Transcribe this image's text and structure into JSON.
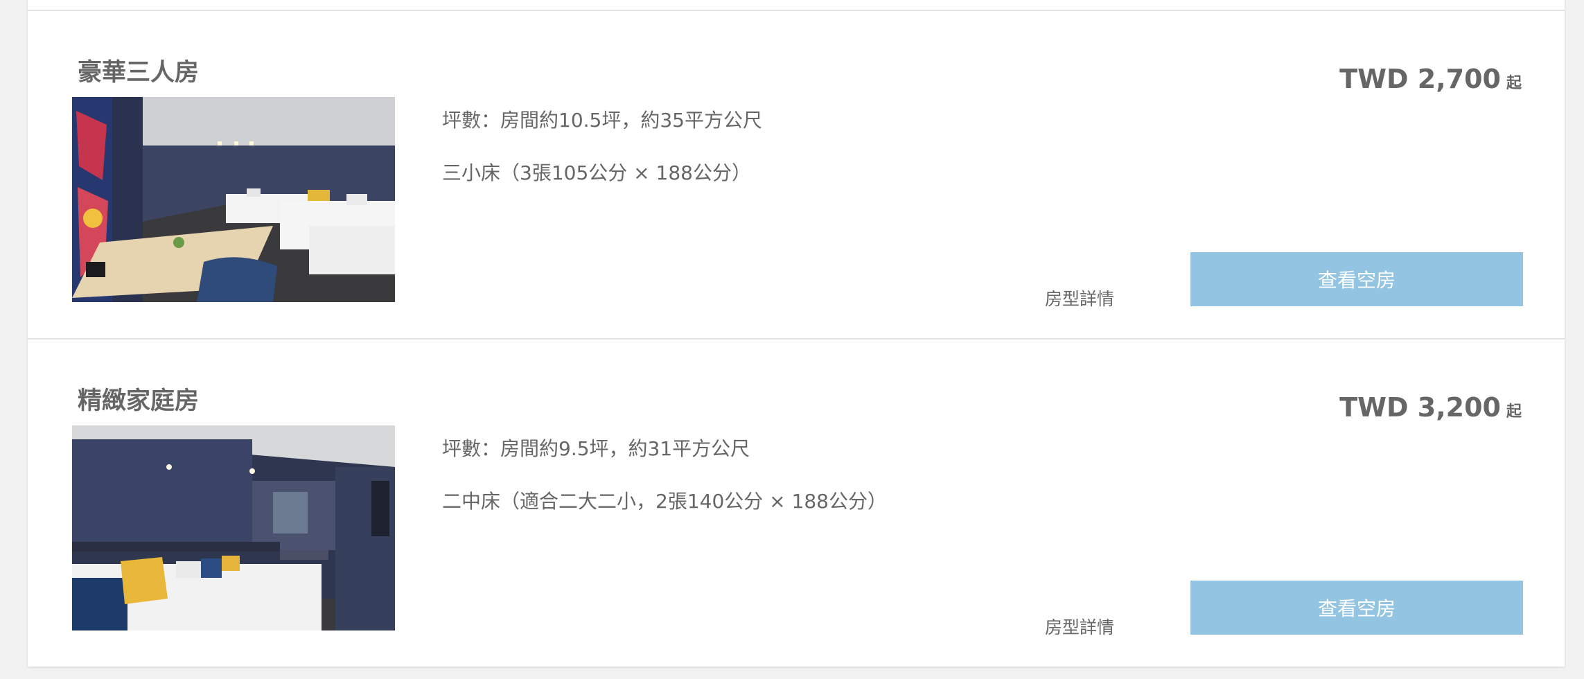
{
  "rooms": [
    {
      "name": "豪華三人房",
      "size": "坪數：房間約10.5坪，約35平方公尺",
      "bed": "三小床（3張105公分 × 188公分）",
      "price": "TWD 2,700",
      "price_suffix": "起",
      "details_label": "房型詳情",
      "check_button": "查看空房"
    },
    {
      "name": "精緻家庭房",
      "size": "坪數：房間約9.5坪，約31平方公尺",
      "bed": "二中床（適合二大二小，2張140公分 × 188公分）",
      "price": "TWD 3,200",
      "price_suffix": "起",
      "details_label": "房型詳情",
      "check_button": "查看空房"
    }
  ],
  "colors": {
    "button_bg": "#93c5e3",
    "button_text": "#ffffff",
    "text": "#666666",
    "page_bg": "#f2f2f2",
    "card_bg": "#ffffff"
  }
}
